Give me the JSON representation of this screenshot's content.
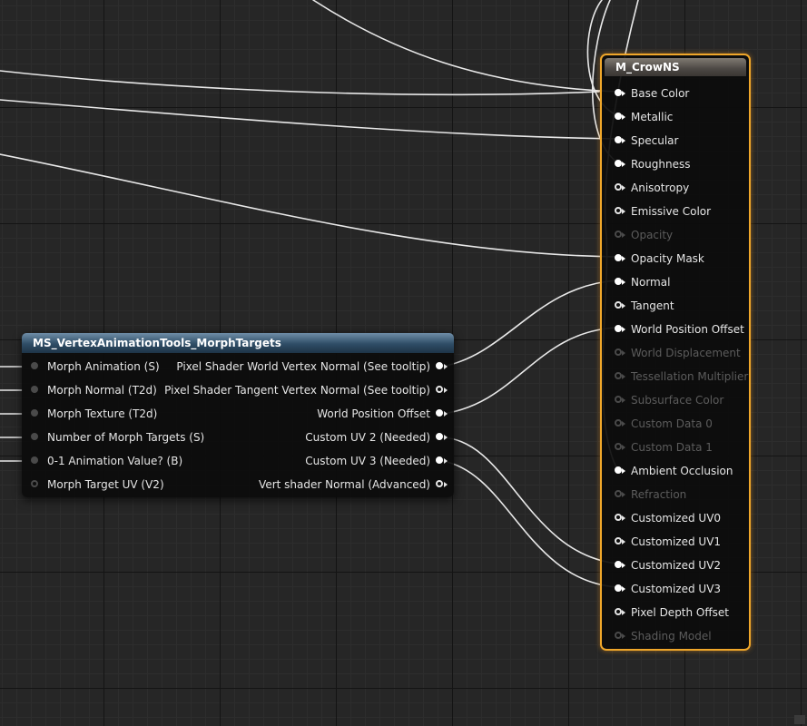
{
  "morph_node": {
    "title": "MS_VertexAnimationTools_MorphTargets",
    "inputs": [
      {
        "label": "Morph Animation (S)",
        "pin": "dim"
      },
      {
        "label": "Morph Normal (T2d)",
        "pin": "dim"
      },
      {
        "label": "Morph Texture (T2d)",
        "pin": "dim"
      },
      {
        "label": "Number of Morph Targets (S)",
        "pin": "dim"
      },
      {
        "label": "0-1 Animation Value? (B)",
        "pin": "dim"
      },
      {
        "label": "Morph Target UV (V2)",
        "pin": "dimhollow"
      }
    ],
    "outputs": [
      {
        "label": "Pixel Shader World Vertex Normal (See tooltip)",
        "pin": "full"
      },
      {
        "label": "Pixel Shader Tangent Vertex Normal (See tooltip)",
        "pin": "hollow"
      },
      {
        "label": "World Position Offset",
        "pin": "full"
      },
      {
        "label": "Custom UV 2 (Needed)",
        "pin": "full"
      },
      {
        "label": "Custom UV 3 (Needed)",
        "pin": "full"
      },
      {
        "label": "Vert shader Normal (Advanced)",
        "pin": "hollow"
      }
    ]
  },
  "material_node": {
    "title": "M_CrowNS",
    "inputs": [
      {
        "label": "Base Color",
        "pin": "full",
        "enabled": true
      },
      {
        "label": "Metallic",
        "pin": "full",
        "enabled": true
      },
      {
        "label": "Specular",
        "pin": "full",
        "enabled": true
      },
      {
        "label": "Roughness",
        "pin": "full",
        "enabled": true
      },
      {
        "label": "Anisotropy",
        "pin": "hollow",
        "enabled": true
      },
      {
        "label": "Emissive Color",
        "pin": "hollow",
        "enabled": true
      },
      {
        "label": "Opacity",
        "pin": "dimhollow",
        "enabled": false
      },
      {
        "label": "Opacity Mask",
        "pin": "full",
        "enabled": true
      },
      {
        "label": "Normal",
        "pin": "full",
        "enabled": true
      },
      {
        "label": "Tangent",
        "pin": "hollow",
        "enabled": true
      },
      {
        "label": "World Position Offset",
        "pin": "full",
        "enabled": true
      },
      {
        "label": "World Displacement",
        "pin": "dimhollow",
        "enabled": false
      },
      {
        "label": "Tessellation Multiplier",
        "pin": "dimhollow",
        "enabled": false
      },
      {
        "label": "Subsurface Color",
        "pin": "dimhollow",
        "enabled": false
      },
      {
        "label": "Custom Data 0",
        "pin": "dimhollow",
        "enabled": false
      },
      {
        "label": "Custom Data 1",
        "pin": "dimhollow",
        "enabled": false
      },
      {
        "label": "Ambient Occlusion",
        "pin": "full",
        "enabled": true
      },
      {
        "label": "Refraction",
        "pin": "dimhollow",
        "enabled": false
      },
      {
        "label": "Customized UV0",
        "pin": "hollow",
        "enabled": true
      },
      {
        "label": "Customized UV1",
        "pin": "hollow",
        "enabled": true
      },
      {
        "label": "Customized UV2",
        "pin": "full",
        "enabled": true
      },
      {
        "label": "Customized UV3",
        "pin": "full",
        "enabled": true
      },
      {
        "label": "Pixel Depth Offset",
        "pin": "hollow",
        "enabled": true
      },
      {
        "label": "Shading Model",
        "pin": "dimhollow",
        "enabled": false
      }
    ]
  },
  "colors": {
    "canvas": "#262626",
    "selection_outline": "#f0a72a",
    "wire": "#e8e8e8"
  }
}
